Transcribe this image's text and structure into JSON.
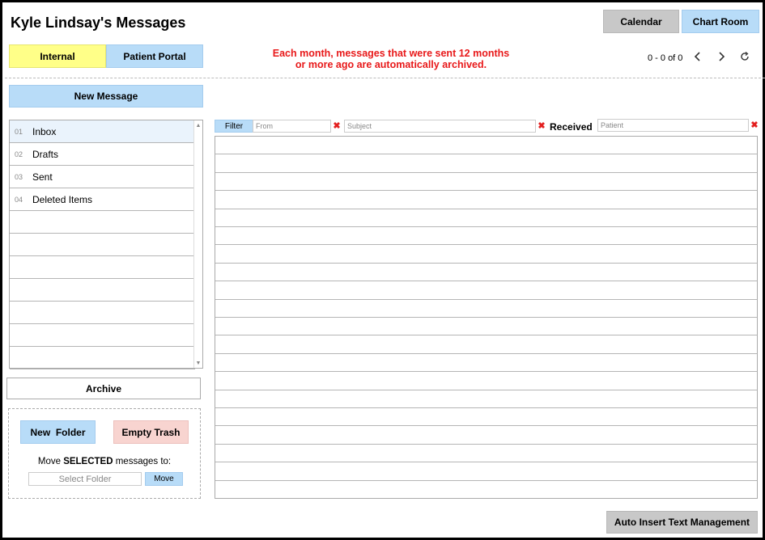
{
  "header": {
    "title": "Kyle Lindsay's Messages",
    "calendar_label": "Calendar",
    "chart_room_label": "Chart Room"
  },
  "tabs": {
    "internal": "Internal",
    "patient_portal": "Patient Portal"
  },
  "notice": {
    "line1": "Each month, messages that were sent 12 months",
    "line2": "or more ago are automatically archived."
  },
  "pager": {
    "count": "0 - 0 of 0",
    "prev_icon": "chevron-left-icon",
    "next_icon": "chevron-right-icon",
    "refresh_icon": "refresh-icon"
  },
  "sidebar": {
    "new_message_label": "New Message",
    "folders": [
      {
        "num": "01",
        "label": "Inbox"
      },
      {
        "num": "02",
        "label": "Drafts"
      },
      {
        "num": "03",
        "label": "Sent"
      },
      {
        "num": "04",
        "label": "Deleted Items"
      }
    ],
    "archive_label": "Archive",
    "new_folder_label": "New  Folder",
    "empty_trash_label": "Empty Trash",
    "move_prefix": "Move ",
    "move_bold": "SELECTED",
    "move_suffix": " messages to:",
    "select_folder_placeholder": "Select Folder",
    "move_label": "Move"
  },
  "filters": {
    "filter_label": "Filter",
    "from_placeholder": "From",
    "subject_placeholder": "Subject",
    "received_label": "Received",
    "patient_placeholder": "Patient",
    "clear_icon": "close-x-icon"
  },
  "footer": {
    "auto_insert_label": "Auto Insert Text Management"
  },
  "colors": {
    "notice": "#e8191a",
    "tab_internal": "#ffff88",
    "blue_button": "#b8dcf8",
    "gray_button": "#c8c8c8",
    "pink_button": "#f8d4d0",
    "clear_x": "#e32020"
  }
}
